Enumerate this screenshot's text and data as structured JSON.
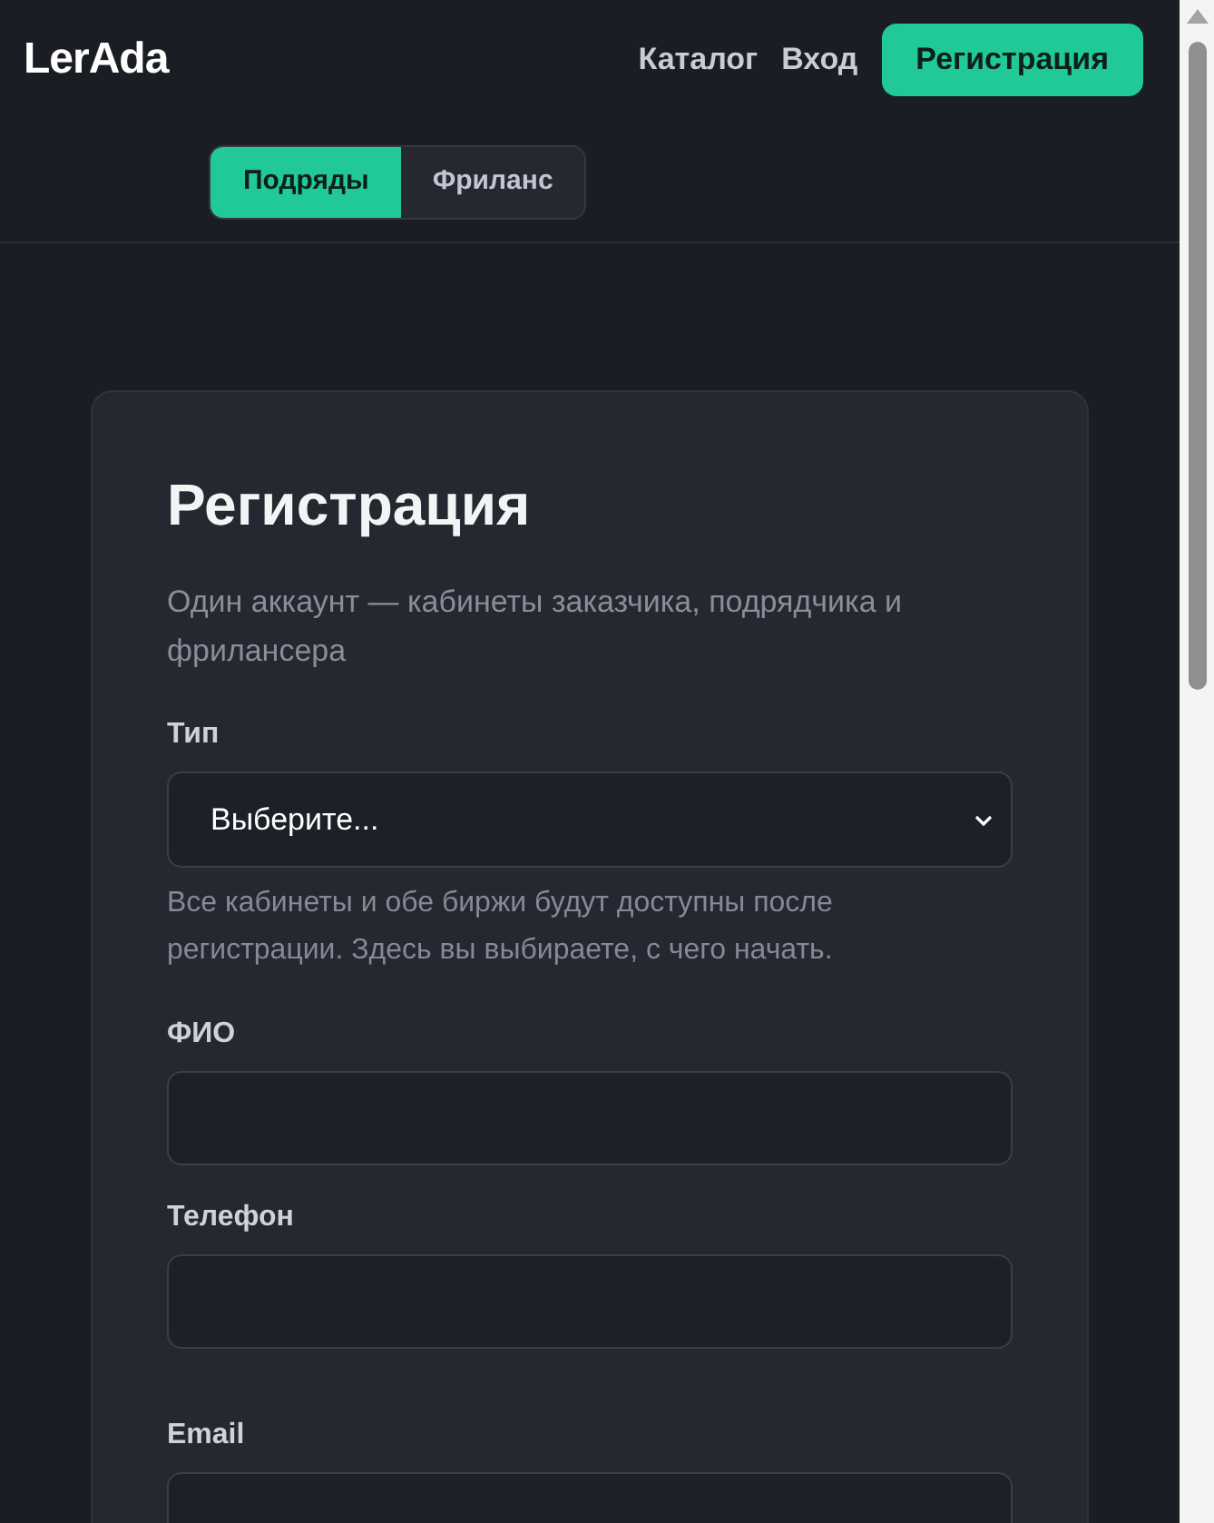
{
  "header": {
    "logo": "LerAda",
    "nav": [
      {
        "label": "Каталог",
        "kind": "link"
      },
      {
        "label": "Вход",
        "kind": "link"
      },
      {
        "label": "Регистрация",
        "kind": "button"
      }
    ]
  },
  "mode_tabs": [
    {
      "label": "Подряды",
      "selected": true
    },
    {
      "label": "Фриланс",
      "selected": false
    }
  ],
  "form": {
    "title": "Регистрация",
    "subtitle": "Один аккаунт — кабинеты заказчика, подрядчика и фрилансера",
    "fields": [
      {
        "kind": "select",
        "label": "Тип",
        "value": "Выберите...",
        "hint": "Все кабинеты и обе биржи будут доступны после регистрации. Здесь вы выбираете, с чего начать."
      },
      {
        "kind": "input",
        "label": "ФИО"
      },
      {
        "kind": "input",
        "label": "Телефон"
      },
      {
        "kind": "input",
        "label": "Email"
      }
    ]
  }
}
